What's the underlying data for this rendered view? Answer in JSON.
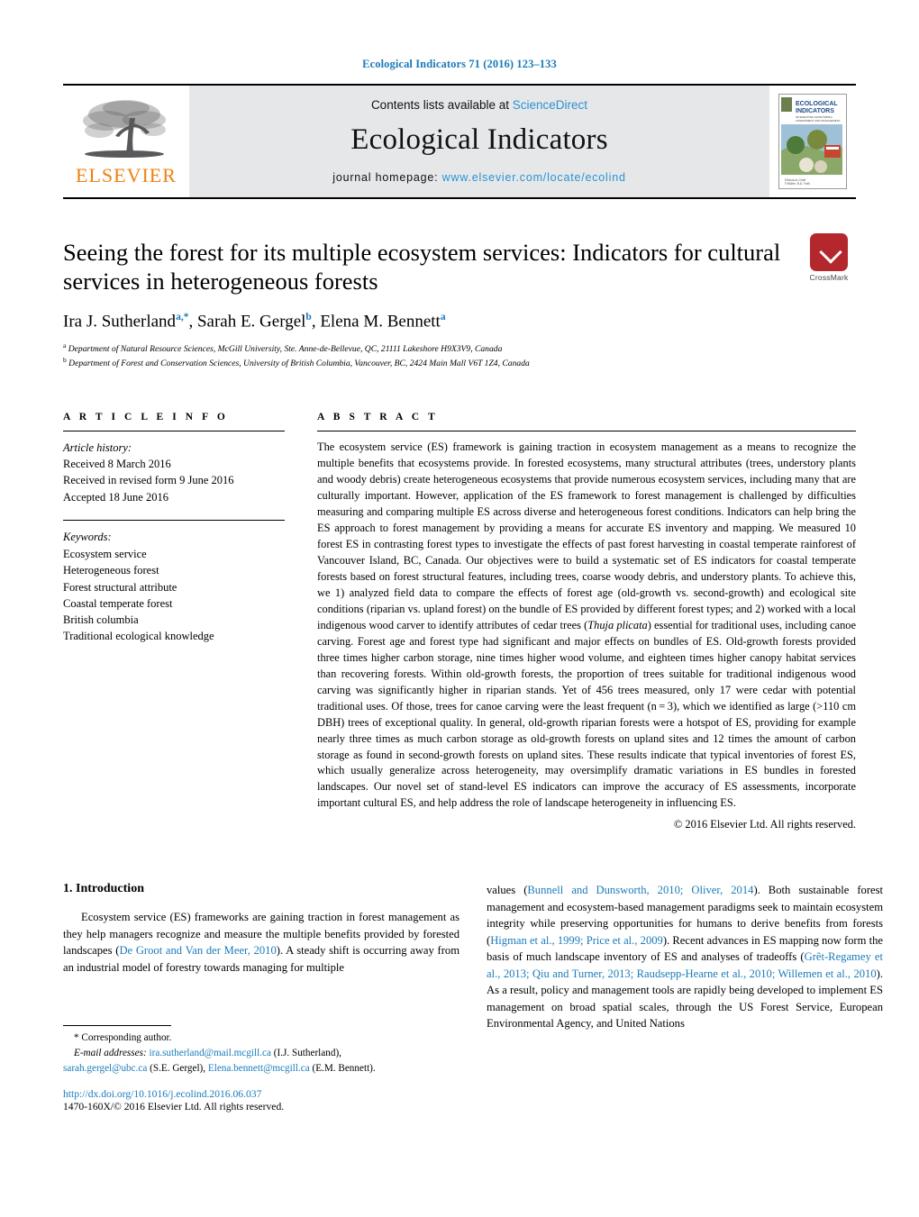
{
  "running_head": "Ecological Indicators 71 (2016) 123–133",
  "masthead": {
    "publisher": "ELSEVIER",
    "contents_prefix": "Contents lists available at ",
    "contents_link": "ScienceDirect",
    "journal_name": "Ecological Indicators",
    "homepage_prefix": "journal homepage: ",
    "homepage_url": "www.elsevier.com/locate/ecolind",
    "cover_title_1": "ECOLOGICAL",
    "cover_title_2": "INDICATORS",
    "cover_subtitle": "INTEGRATING MONITORING, ASSESSMENT AND MANAGEMENT"
  },
  "article": {
    "title": "Seeing the forest for its multiple ecosystem services: Indicators for cultural services in heterogeneous forests",
    "crossmark_label": "CrossMark",
    "authors": [
      {
        "name": "Ira J. Sutherland",
        "sup": "a,*"
      },
      {
        "name": "Sarah E. Gergel",
        "sup": "b"
      },
      {
        "name": "Elena M. Bennett",
        "sup": "a"
      }
    ],
    "affiliations": [
      {
        "sup": "a",
        "text": "Department of Natural Resource Sciences, McGill University, Ste. Anne-de-Bellevue, QC, 21111 Lakeshore H9X3V9, Canada"
      },
      {
        "sup": "b",
        "text": "Department of Forest and Conservation Sciences, University of British Columbia, Vancouver, BC, 2424 Main Mall V6T 1Z4, Canada"
      }
    ]
  },
  "article_info": {
    "heading": "A R T I C L E   I N F O",
    "history_label": "Article history:",
    "history": [
      "Received 8 March 2016",
      "Received in revised form 9 June 2016",
      "Accepted 18 June 2016"
    ],
    "keywords_label": "Keywords:",
    "keywords": [
      "Ecosystem service",
      "Heterogeneous forest",
      "Forest structural attribute",
      "Coastal temperate forest",
      "British columbia",
      "Traditional ecological knowledge"
    ]
  },
  "abstract": {
    "heading": "A B S T R A C T",
    "part1": "The ecosystem service (ES) framework is gaining traction in ecosystem management as a means to recognize the multiple benefits that ecosystems provide. In forested ecosystems, many structural attributes (trees, understory plants and woody debris) create heterogeneous ecosystems that provide numerous ecosystem services, including many that are culturally important. However, application of the ES framework to forest management is challenged by difficulties measuring and comparing multiple ES across diverse and heterogeneous forest conditions. Indicators can help bring the ES approach to forest management by providing a means for accurate ES inventory and mapping. We measured 10 forest ES in contrasting forest types to investigate the effects of past forest harvesting in coastal temperate rainforest of Vancouver Island, BC, Canada. Our objectives were to build a systematic set of ES indicators for coastal temperate forests based on forest structural features, including trees, coarse woody debris, and understory plants. To achieve this, we 1) analyzed field data to compare the effects of forest age (old-growth vs. second-growth) and ecological site conditions (riparian vs. upland forest) on the bundle of ES provided by different forest types; and 2) worked with a local indigenous wood carver to identify attributes of cedar trees (",
    "species": "Thuja plicata",
    "part2": ") essential for traditional uses, including canoe carving. Forest age and forest type had significant and major effects on bundles of ES. Old-growth forests provided three times higher carbon storage, nine times higher wood volume, and eighteen times higher canopy habitat services than recovering forests. Within old-growth forests, the proportion of trees suitable for traditional indigenous wood carving was significantly higher in riparian stands. Yet of 456 trees measured, only 17 were cedar with potential traditional uses. Of those, trees for canoe carving were the least frequent (n = 3), which we identified as large (>110 cm DBH) trees of exceptional quality. In general, old-growth riparian forests were a hotspot of ES, providing for example nearly three times as much carbon storage as old-growth forests on upland sites and 12 times the amount of carbon storage as found in second-growth forests on upland sites. These results indicate that typical inventories of forest ES, which usually generalize across heterogeneity, may oversimplify dramatic variations in ES bundles in forested landscapes. Our novel set of stand-level ES indicators can improve the accuracy of ES assessments, incorporate important cultural ES, and help address the role of landscape heterogeneity in influencing ES.",
    "copyright": "© 2016 Elsevier Ltd. All rights reserved."
  },
  "introduction": {
    "heading": "1.  Introduction",
    "left_p1_a": "Ecosystem service (ES) frameworks are gaining traction in forest management as they help managers recognize and measure the multiple benefits provided by forested landscapes (",
    "left_cit1": "De Groot and Van der Meer, 2010",
    "left_p1_b": "). A steady shift is occurring away from an industrial model of forestry towards managing for multiple",
    "right_p1_a": "values (",
    "right_cit1": "Bunnell and Dunsworth, 2010; Oliver, 2014",
    "right_p1_b": "). Both sustainable forest management and ecosystem-based management paradigms seek to maintain ecosystem integrity while preserving opportunities for humans to derive benefits from forests (",
    "right_cit2": "Higman et al., 1999; Price et al., 2009",
    "right_p1_c": "). Recent advances in ES mapping now form the basis of much landscape inventory of ES and analyses of tradeoffs (",
    "right_cit3": "Grêt-Regamey et al., 2013; Qiu and Turner, 2013; Raudsepp-Hearne et al., 2010; Willemen et al., 2010",
    "right_p1_d": "). As a result, policy and management tools are rapidly being developed to implement ES management on broad spatial scales, through the US Forest Service, European Environmental Agency, and United Nations"
  },
  "footnotes": {
    "corresponding": "* Corresponding author.",
    "email_label": "E-mail addresses:",
    "email1": "ira.sutherland@mail.mcgill.ca",
    "email1_owner": "(I.J. Sutherland),",
    "email2": "sarah.gergel@ubc.ca",
    "email2_owner": "(S.E. Gergel),",
    "email3": "Elena.bennett@mcgill.ca",
    "email3_owner": "(E.M. Bennett).",
    "doi": "http://dx.doi.org/10.1016/j.ecolind.2016.06.037",
    "issn": "1470-160X/© 2016 Elsevier Ltd. All rights reserved."
  },
  "colors": {
    "link_blue": "#1a7bb9",
    "elsevier_orange": "#f08010",
    "masthead_gray": "#e6e7e9",
    "crossmark_red": "#b3272d"
  }
}
